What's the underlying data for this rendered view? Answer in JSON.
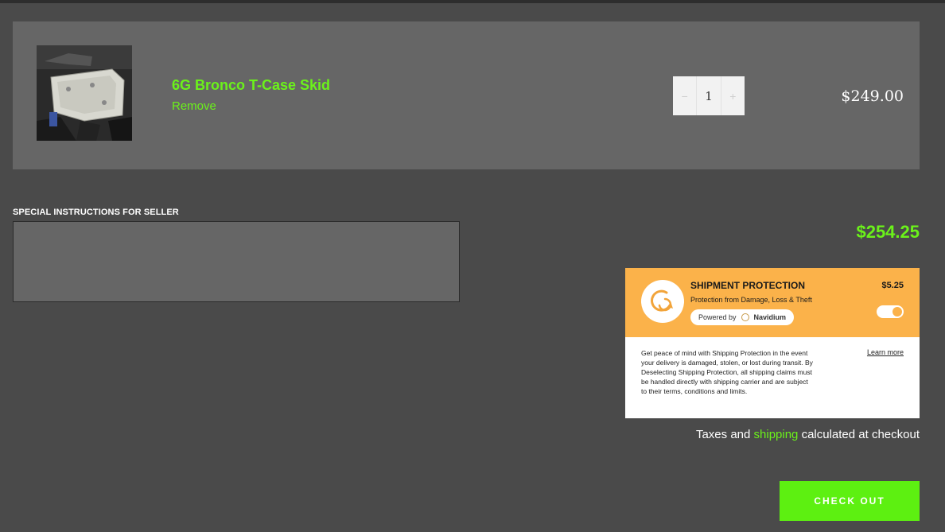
{
  "product": {
    "title": "6G Bronco T-Case Skid",
    "remove_label": "Remove",
    "quantity": "1",
    "qty_minus": "−",
    "qty_plus": "+",
    "price": "$249.00",
    "image_icon": "skid-plate-photo"
  },
  "instructions": {
    "label": "SPECIAL INSTRUCTIONS FOR SELLER",
    "value": ""
  },
  "subtotal": "$254.25",
  "shipment_protection": {
    "title": "SHIPMENT PROTECTION",
    "subtitle": "Protection from Damage, Loss & Theft",
    "powered_by": "Powered by",
    "brand": "Navidium",
    "price": "$5.25",
    "enabled": true,
    "description": "Get peace of mind with Shipping Protection in the event your delivery is damaged, stolen, or lost during transit. By Deselecting Shipping Protection, all shipping claims must be handled directly with shipping carrier and are subject to their terms, conditions and limits.",
    "learn_more": "Learn more"
  },
  "tax_note": {
    "before": "Taxes and ",
    "link": "shipping",
    "after": " calculated at checkout"
  },
  "checkout_label": "CHECK OUT",
  "colors": {
    "accent_green": "#6bf21a",
    "protection_orange": "#fbb24a",
    "background": "#4a4a4a",
    "panel": "#666666"
  }
}
